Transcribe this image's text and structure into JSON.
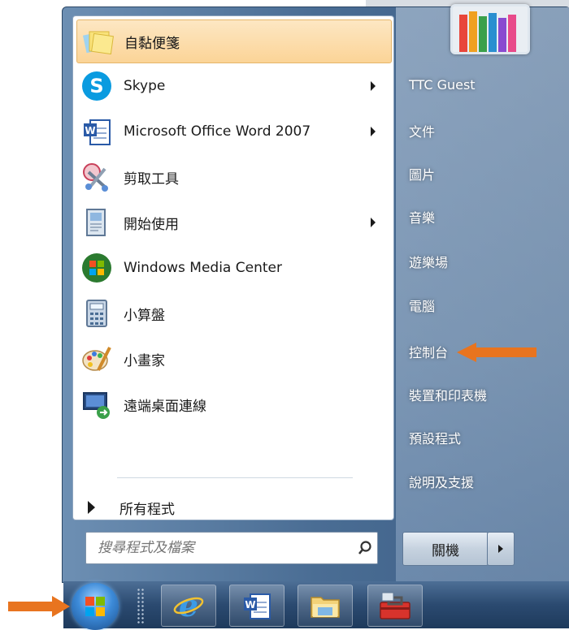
{
  "left_panel": {
    "items": [
      {
        "label": "自黏便箋",
        "icon": "sticky-notes-icon",
        "submenu": false,
        "highlighted": true
      },
      {
        "label": "Skype",
        "icon": "skype-icon",
        "submenu": true,
        "highlighted": false
      },
      {
        "label": "Microsoft Office Word 2007",
        "icon": "word-icon",
        "submenu": true,
        "highlighted": false
      },
      {
        "label": "剪取工具",
        "icon": "snipping-tool-icon",
        "submenu": false,
        "highlighted": false
      },
      {
        "label": "開始使用",
        "icon": "getting-started-icon",
        "submenu": true,
        "highlighted": false
      },
      {
        "label": "Windows Media Center",
        "icon": "media-center-icon",
        "submenu": false,
        "highlighted": false
      },
      {
        "label": "小算盤",
        "icon": "calculator-icon",
        "submenu": false,
        "highlighted": false
      },
      {
        "label": "小畫家",
        "icon": "paint-icon",
        "submenu": false,
        "highlighted": false
      },
      {
        "label": "遠端桌面連線",
        "icon": "remote-desktop-icon",
        "submenu": false,
        "highlighted": false
      }
    ],
    "all_programs": "所有程式",
    "search": {
      "placeholder": "搜尋程式及檔案"
    }
  },
  "right_panel": {
    "items": [
      {
        "label": "TTC Guest"
      },
      {
        "label": "文件"
      },
      {
        "label": "圖片"
      },
      {
        "label": "音樂"
      },
      {
        "label": "遊樂場"
      },
      {
        "label": "電腦"
      },
      {
        "label": "控制台"
      },
      {
        "label": "裝置和印表機"
      },
      {
        "label": "預設程式"
      },
      {
        "label": "說明及支援"
      }
    ],
    "shutdown_label": "關機"
  },
  "taskbar": {
    "buttons": [
      {
        "icon": "internet-explorer-icon"
      },
      {
        "icon": "word-icon"
      },
      {
        "icon": "file-explorer-icon"
      },
      {
        "icon": "toolbox-icon"
      }
    ]
  },
  "colors": {
    "highlight": "#fbd497",
    "annotation_arrow": "#e8741f"
  }
}
